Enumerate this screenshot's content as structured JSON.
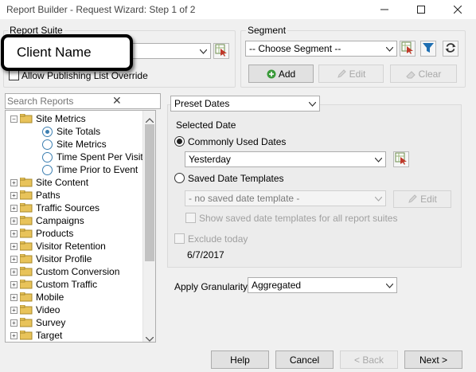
{
  "window": {
    "title": "Report Builder - Request Wizard: Step 1 of 2",
    "minimize_icon": "minimize-icon",
    "maximize_icon": "maximize-icon",
    "close_icon": "close-icon"
  },
  "report_suite": {
    "label": "Report Suite",
    "value": "",
    "callout_text": "Client Name",
    "allow_override_label": "Allow Publishing List Override"
  },
  "segment": {
    "label": "Segment",
    "value": "-- Choose Segment --",
    "add_label": "Add",
    "edit_label": "Edit",
    "clear_label": "Clear"
  },
  "search": {
    "placeholder": "Search Reports",
    "clear_glyph": "✕"
  },
  "tree": {
    "items": [
      {
        "label": "Site Metrics",
        "type": "folder",
        "expanded": true
      },
      {
        "label": "Site Totals",
        "type": "radio",
        "selected": true
      },
      {
        "label": "Site Metrics",
        "type": "radio"
      },
      {
        "label": "Time Spent Per Visit",
        "type": "radio"
      },
      {
        "label": "Time Prior to Event",
        "type": "radio"
      },
      {
        "label": "Site Content",
        "type": "folder"
      },
      {
        "label": "Paths",
        "type": "folder"
      },
      {
        "label": "Traffic Sources",
        "type": "folder"
      },
      {
        "label": "Campaigns",
        "type": "folder"
      },
      {
        "label": "Products",
        "type": "folder"
      },
      {
        "label": "Visitor Retention",
        "type": "folder"
      },
      {
        "label": "Visitor Profile",
        "type": "folder"
      },
      {
        "label": "Custom Conversion",
        "type": "folder"
      },
      {
        "label": "Custom Traffic",
        "type": "folder"
      },
      {
        "label": "Mobile",
        "type": "folder"
      },
      {
        "label": "Video",
        "type": "folder"
      },
      {
        "label": "Survey",
        "type": "folder"
      },
      {
        "label": "Target",
        "type": "folder"
      }
    ]
  },
  "dates": {
    "preset_label": "Preset Dates",
    "selected_date_label": "Selected Date",
    "common_label": "Commonly Used Dates",
    "common_value": "Yesterday",
    "saved_label": "Saved Date Templates",
    "saved_value": "- no saved date template -",
    "saved_edit_label": "Edit",
    "show_all_label": "Show saved date templates for all report suites",
    "exclude_today_label": "Exclude today",
    "date_value": "6/7/2017"
  },
  "granularity": {
    "label": "Apply Granularity",
    "value": "Aggregated"
  },
  "footer": {
    "help_label": "Help",
    "cancel_label": "Cancel",
    "back_label": "< Back",
    "next_label": "Next >"
  },
  "colors": {
    "filter_icon": "#1f6fb2",
    "red_arrow": "#c0392b",
    "folder": "#e8c35a",
    "add_icon": "#3a9a3a"
  }
}
